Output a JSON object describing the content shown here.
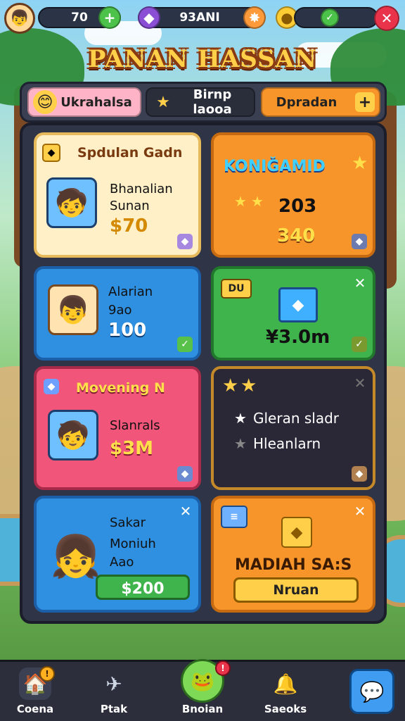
{
  "hud": {
    "coins": "70",
    "gems": "93ANI",
    "avatar_icon": "player-avatar-icon",
    "add_icon": "+",
    "close_icon": "✕",
    "check_icon": "✓"
  },
  "title": "PANAN HASSAN",
  "tabs": [
    {
      "label": "Ukrahalsa",
      "icon": "😊"
    },
    {
      "label": "Birnp laooa",
      "icon": "★"
    },
    {
      "label": "Dpradan",
      "icon": "+"
    }
  ],
  "cards": {
    "c1": {
      "title": "Spdulan Gadn",
      "line1": "Bhanalian",
      "line2": "Sunan",
      "price": "$70",
      "portrait": "🧒"
    },
    "c2": {
      "title": "KONIĞAMID",
      "value1": "203",
      "value2": "340"
    },
    "c3": {
      "line1": "Alarian",
      "line2": "9ao",
      "value": "100",
      "portrait": "👦"
    },
    "c4": {
      "tag": "DU",
      "value": "¥3.0m"
    },
    "c5": {
      "title": "Movening N",
      "line1": "Slanrals",
      "price": "$3M",
      "portrait": "🧒"
    },
    "c6": {
      "line1": "Gleran sladr",
      "line2": "Hleanlarn"
    },
    "c7": {
      "line1": "Sakar",
      "line2": "Moniuh",
      "line3": "Aao",
      "button": "$200",
      "portrait": "👧"
    },
    "c8": {
      "title": "MADIAH SA:S",
      "button": "Nruan"
    }
  },
  "nav": [
    {
      "label": "Coena",
      "icon": "🏠"
    },
    {
      "label": "Ptak",
      "icon": "✈"
    },
    {
      "label": "Bnoian",
      "icon": "🐸"
    },
    {
      "label": "Saeoks",
      "icon": "🔔"
    },
    {
      "label": "",
      "icon": "💬"
    }
  ],
  "colors": {
    "gold": "#ffcf4a",
    "orange": "#f7952b",
    "blue": "#2f8fe0",
    "green": "#3fb34c",
    "pink": "#f1567a",
    "dark": "#2a2736"
  }
}
